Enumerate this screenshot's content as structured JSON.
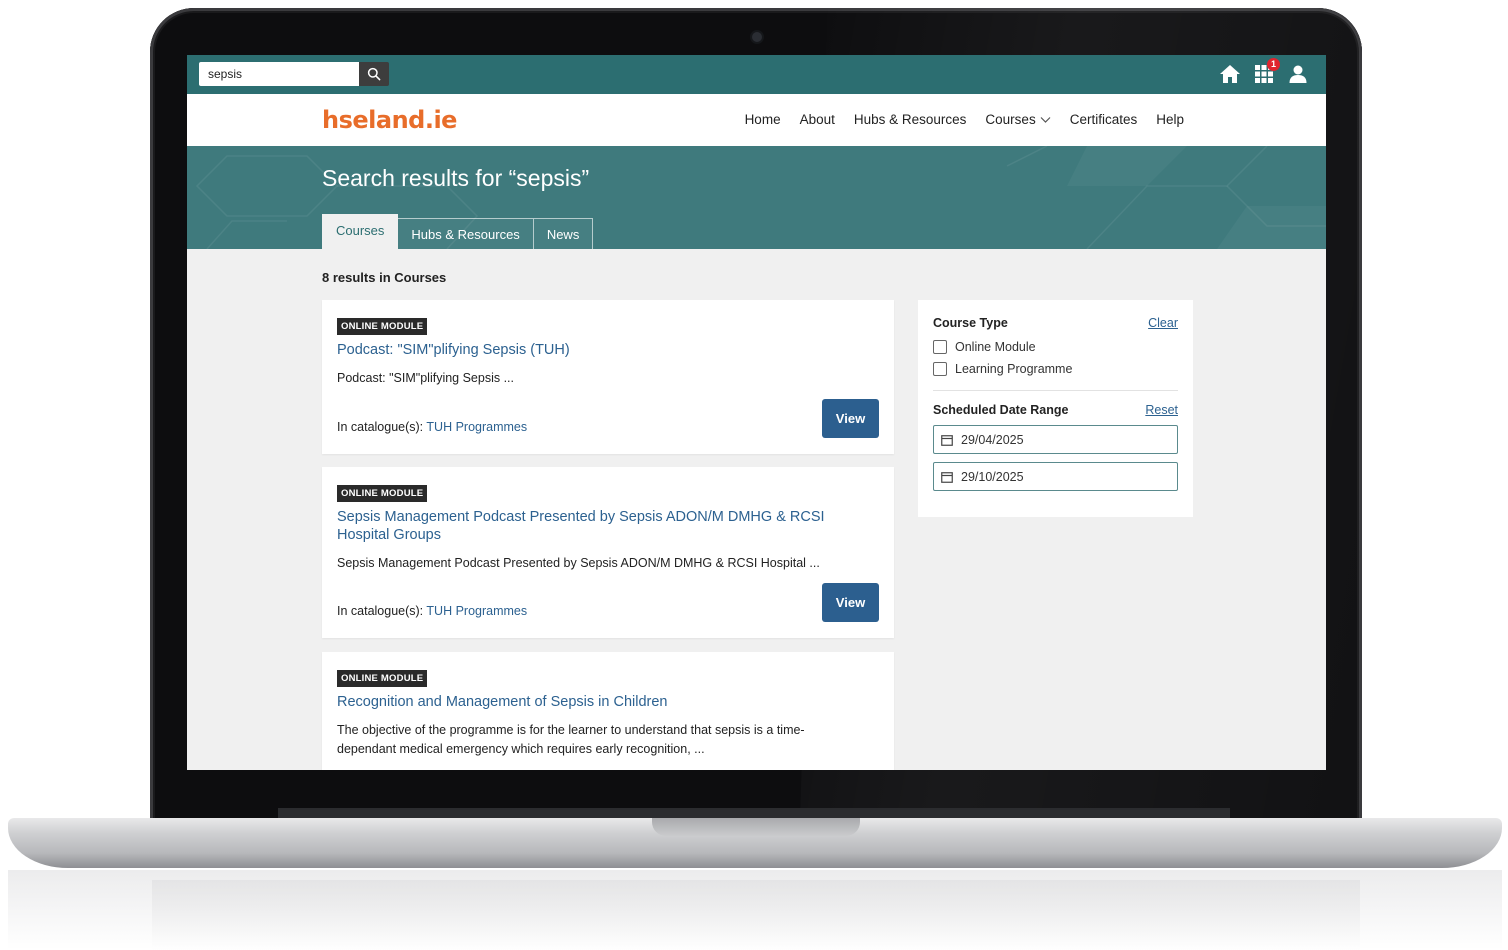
{
  "topbar": {
    "search_value": "sepsis",
    "notification_count": "1"
  },
  "navbar": {
    "logo": "hseland.ie",
    "links": [
      "Home",
      "About",
      "Hubs & Resources",
      "Courses",
      "Certificates",
      "Help"
    ]
  },
  "hero": {
    "title": "Search results for “sepsis”",
    "tabs": [
      "Courses",
      "Hubs & Resources",
      "News"
    ]
  },
  "results": {
    "count": "8 results in Courses",
    "catalogue_prefix": "In catalogue(s):",
    "view_label": "View",
    "items": [
      {
        "badge": "ONLINE MODULE",
        "title": "Podcast: \"SIM\"plifying Sepsis (TUH)",
        "description": "Podcast: \"SIM\"plifying Sepsis ...",
        "catalogue": "TUH Programmes"
      },
      {
        "badge": "ONLINE MODULE",
        "title": "Sepsis Management Podcast Presented by Sepsis ADON/M DMHG & RCSI Hospital Groups",
        "description": "Sepsis Management Podcast Presented by Sepsis ADON/M DMHG & RCSI Hospital ...",
        "catalogue": "TUH Programmes"
      },
      {
        "badge": "ONLINE MODULE",
        "title": "Recognition and Management of Sepsis in Children",
        "description": "The objective of the programme is for the learner to understand that sepsis is a time-dependant medical emergency which requires early recognition, ..."
      }
    ]
  },
  "filters": {
    "course_type_label": "Course Type",
    "clear_label": "Clear",
    "options": [
      "Online Module",
      "Learning Programme"
    ],
    "date_range_label": "Scheduled Date Range",
    "reset_label": "Reset",
    "date_from": "29/04/2025",
    "date_to": "29/10/2025"
  },
  "colors": {
    "topbar": "#2c6e71",
    "hero": "#3f7a7d",
    "link": "#2c6190",
    "button": "#2c5f8f",
    "logo": "#e86d2a"
  }
}
